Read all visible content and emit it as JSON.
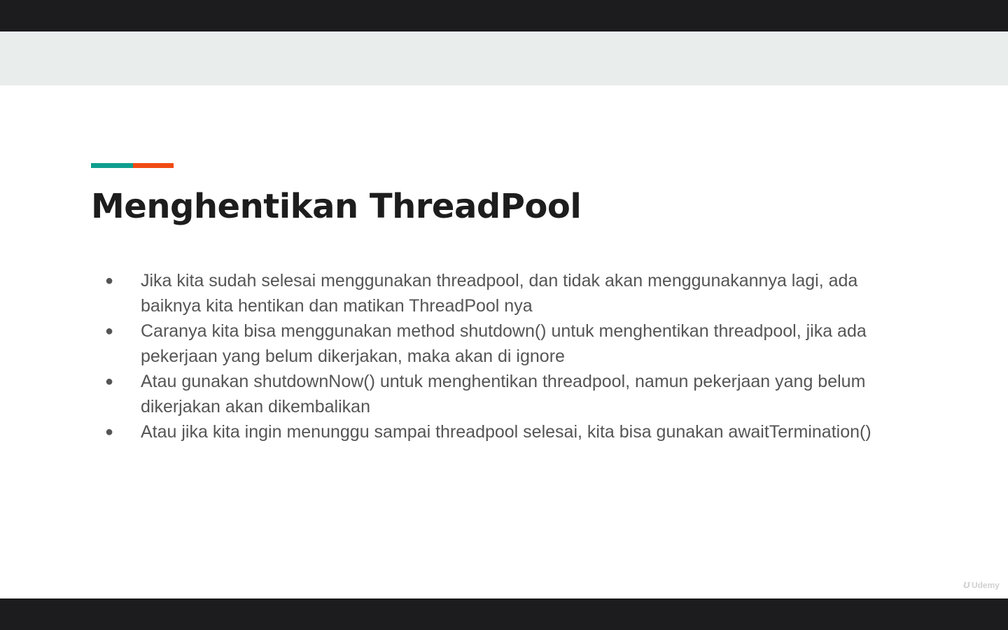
{
  "colors": {
    "accent_teal": "#0e9e8e",
    "accent_orange": "#f04a14"
  },
  "slide": {
    "title": "Menghentikan ThreadPool",
    "bullets": [
      "Jika kita sudah selesai menggunakan threadpool, dan tidak akan menggunakannya lagi, ada baiknya kita hentikan dan matikan ThreadPool nya",
      "Caranya kita bisa menggunakan method shutdown() untuk menghentikan threadpool, jika ada pekerjaan yang belum dikerjakan, maka akan di ignore",
      "Atau gunakan shutdownNow() untuk menghentikan threadpool, namun pekerjaan yang belum dikerjakan akan dikembalikan",
      "Atau jika kita ingin menunggu sampai threadpool selesai, kita bisa gunakan awaitTermination()"
    ],
    "bullet_glyph": "●"
  },
  "watermark": {
    "brand": "Udemy",
    "icon": "udemy-logo-icon"
  }
}
